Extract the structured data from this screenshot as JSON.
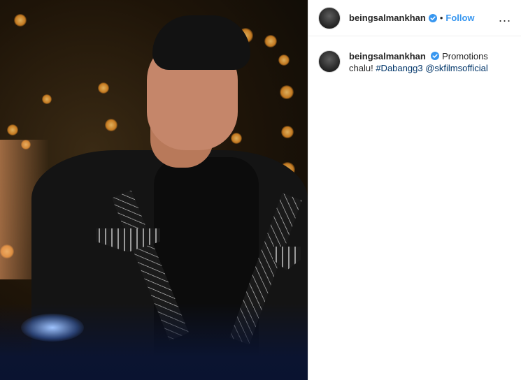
{
  "post": {
    "username": "beingsalmankhan",
    "follow_label": "Follow",
    "dot": "•",
    "more": "...",
    "caption": {
      "username": "beingsalmankhan",
      "text": "Promotions chalu!",
      "hashtag": "#Dabangg3",
      "mention": "@skfilmsofficial"
    }
  },
  "icons": {
    "verified": "verified-badge-icon",
    "more": "more-options-icon"
  },
  "colors": {
    "accent": "#3897f0",
    "link": "#003569",
    "text": "#262626",
    "divider": "#efefef"
  }
}
